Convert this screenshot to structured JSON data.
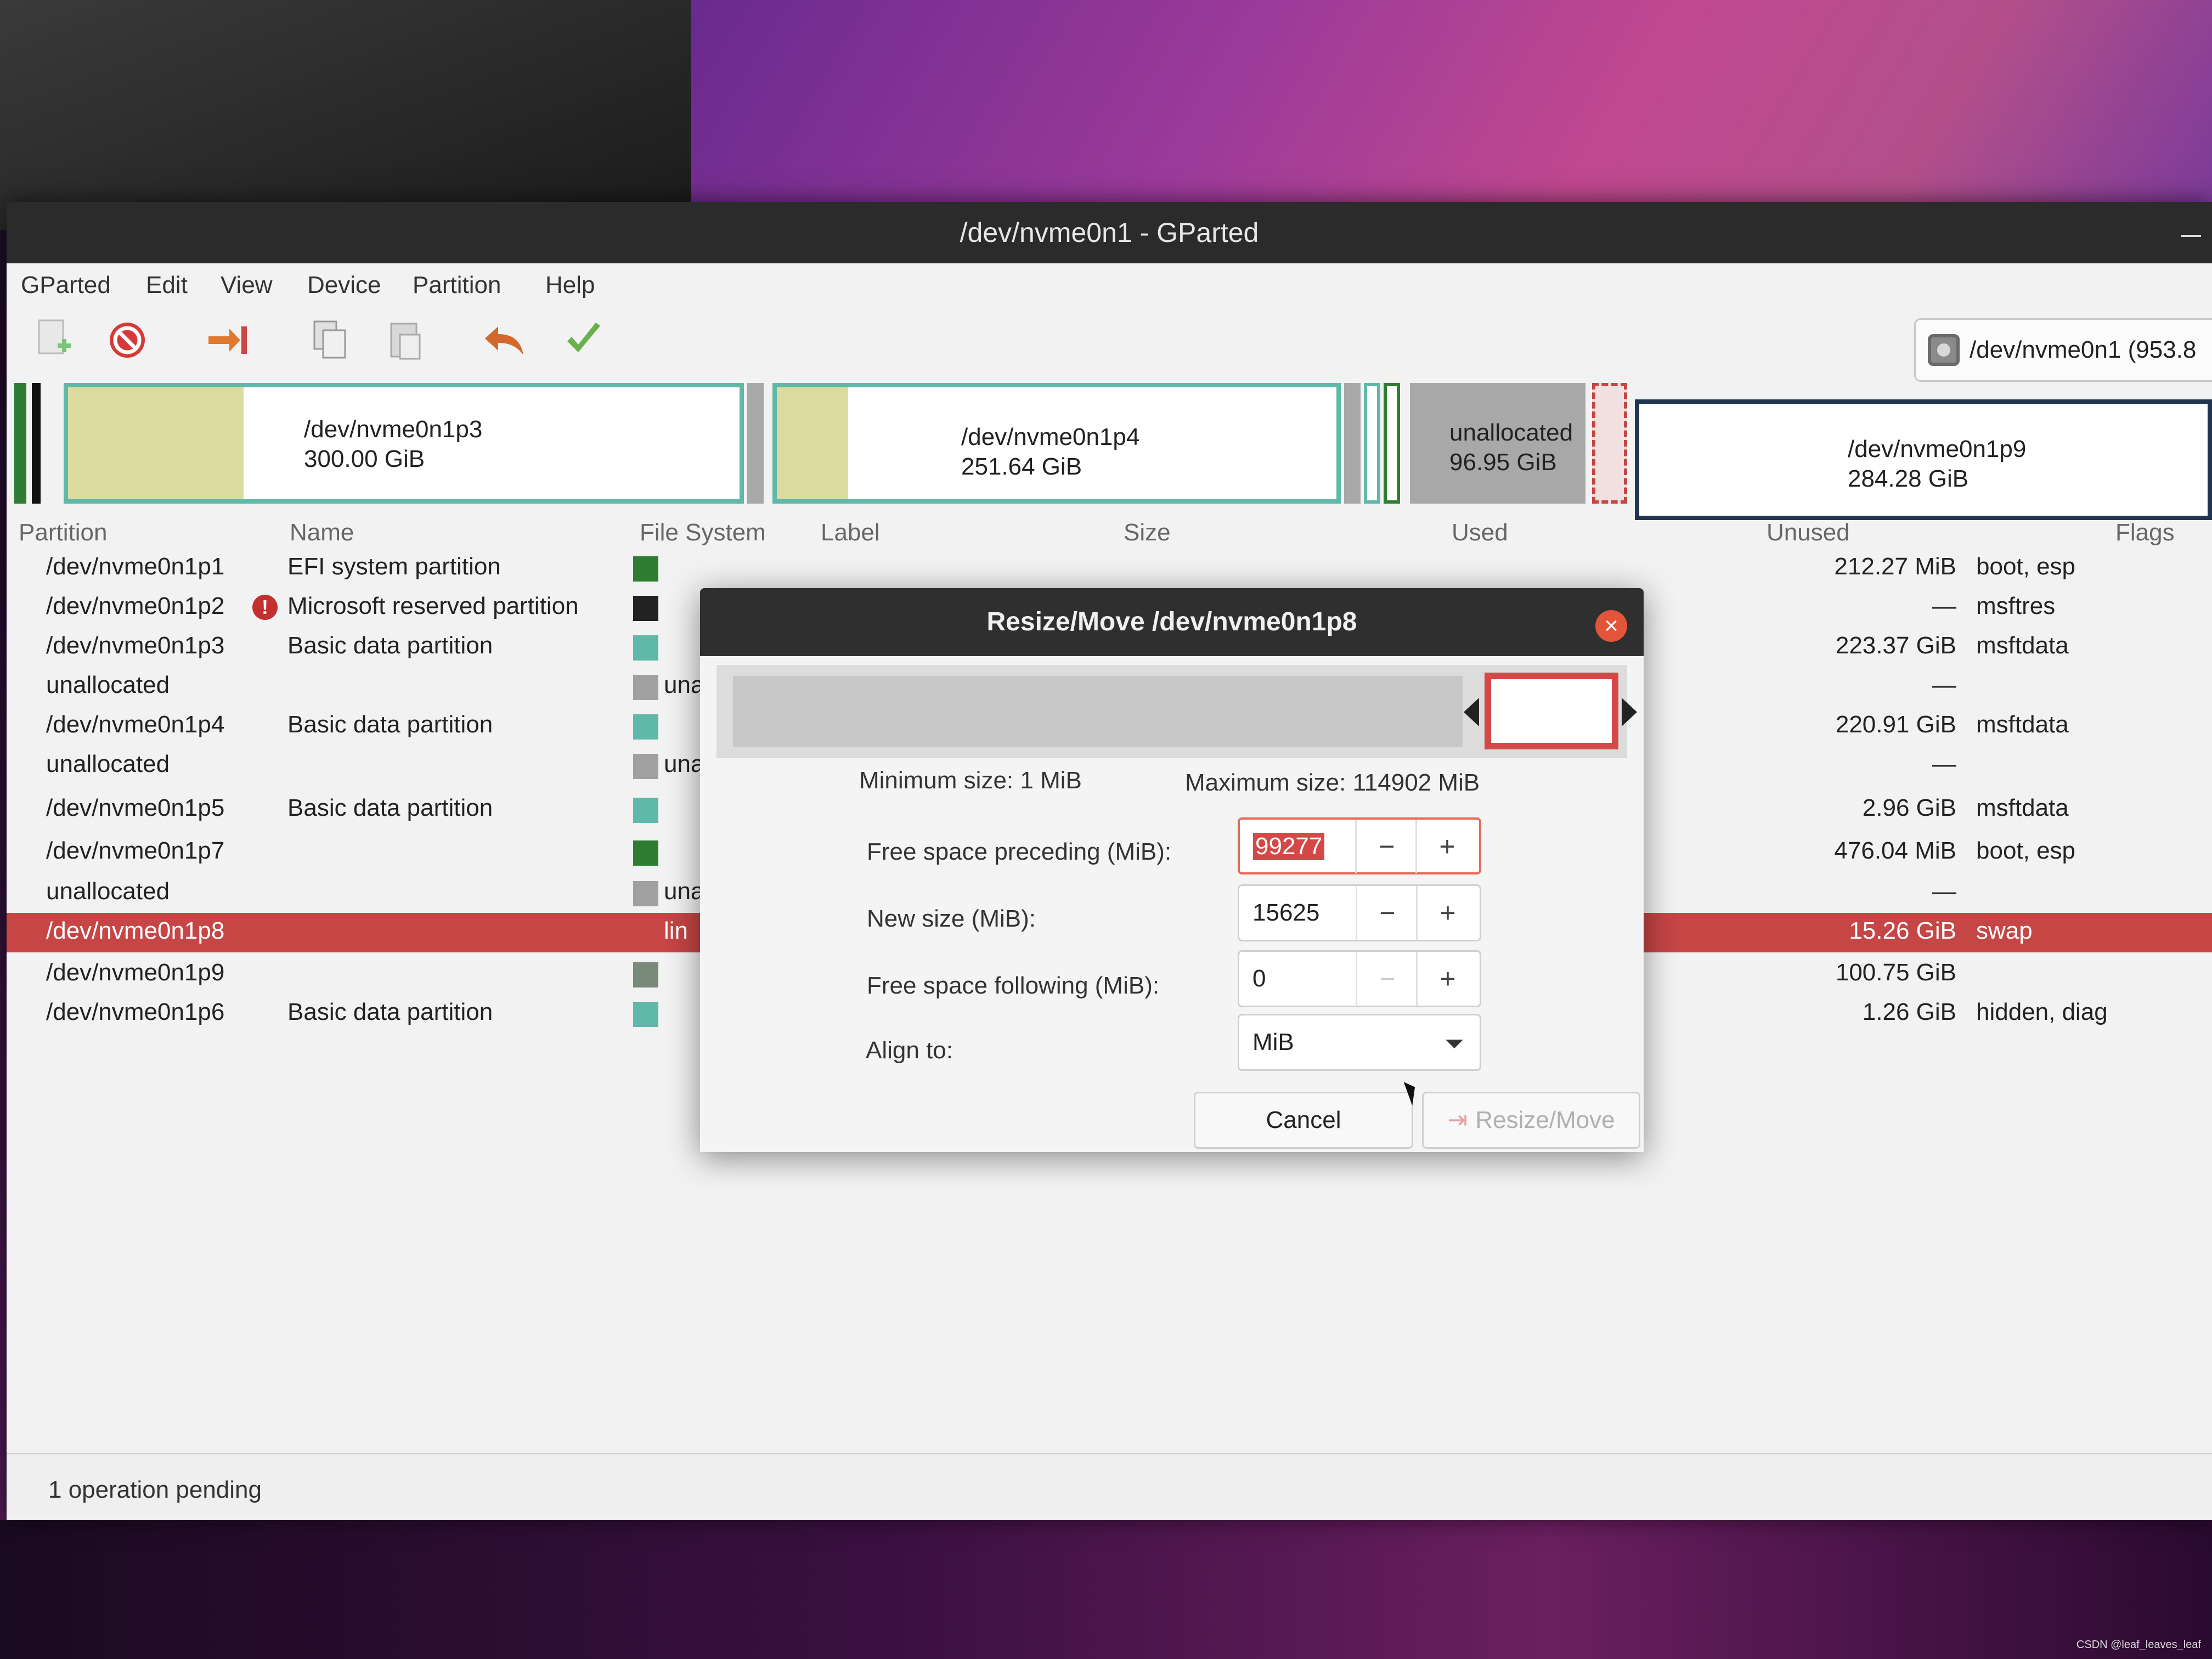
{
  "window": {
    "title": "/dev/nvme0n1 - GParted"
  },
  "menu": [
    "GParted",
    "Edit",
    "View",
    "Device",
    "Partition",
    "Help"
  ],
  "device_selector": {
    "label": "/dev/nvme0n1 (953.8"
  },
  "diskbar": {
    "p3": {
      "name": "/dev/nvme0n1p3",
      "size": "300.00 GiB"
    },
    "p4": {
      "name": "/dev/nvme0n1p4",
      "size": "251.64 GiB"
    },
    "unalloc": {
      "name": "unallocated",
      "size": "96.95 GiB"
    },
    "p9": {
      "name": "/dev/nvme0n1p9",
      "size": "284.28 GiB"
    }
  },
  "columns": {
    "partition": "Partition",
    "name": "Name",
    "filesystem": "File System",
    "label": "Label",
    "size": "Size",
    "used": "Used",
    "unused": "Unused",
    "flags": "Flags"
  },
  "rows": [
    {
      "partition": "/dev/nvme0n1p1",
      "name": "EFI system partition",
      "color": "#2e7d32",
      "fs": "",
      "unused": "212.27 MiB",
      "flags": "boot, esp"
    },
    {
      "partition": "/dev/nvme0n1p2",
      "name": "Microsoft reserved partition",
      "color": "#222222",
      "fs": "",
      "unused": "—",
      "flags": "msftres",
      "warn": "!"
    },
    {
      "partition": "/dev/nvme0n1p3",
      "name": "Basic data partition",
      "color": "#5fb8a8",
      "fs": "",
      "unused": "223.37 GiB",
      "flags": "msftdata"
    },
    {
      "partition": "unallocated",
      "name": "",
      "color": "#a0a0a0",
      "fs": "una",
      "unused": "—",
      "flags": ""
    },
    {
      "partition": "/dev/nvme0n1p4",
      "name": "Basic data partition",
      "color": "#5fb8a8",
      "fs": "",
      "unused": "220.91 GiB",
      "flags": "msftdata"
    },
    {
      "partition": "unallocated",
      "name": "",
      "color": "#a0a0a0",
      "fs": "una",
      "unused": "—",
      "flags": ""
    },
    {
      "partition": "/dev/nvme0n1p5",
      "name": "Basic data partition",
      "color": "#5fb8a8",
      "fs": "",
      "unused": "2.96 GiB",
      "flags": "msftdata"
    },
    {
      "partition": "/dev/nvme0n1p7",
      "name": "",
      "color": "#2e7d32",
      "fs": "",
      "unused": "476.04 MiB",
      "flags": "boot, esp"
    },
    {
      "partition": "unallocated",
      "name": "",
      "color": "#a0a0a0",
      "fs": "una",
      "unused": "—",
      "flags": ""
    },
    {
      "partition": "/dev/nvme0n1p8",
      "name": "",
      "color": "#c64545",
      "fs": "lin",
      "unused": "15.26 GiB",
      "flags": "swap",
      "selected": true
    },
    {
      "partition": "/dev/nvme0n1p9",
      "name": "",
      "color": "#7a8a7a",
      "fs": "",
      "unused": "100.75 GiB",
      "flags": ""
    },
    {
      "partition": "/dev/nvme0n1p6",
      "name": "Basic data partition",
      "color": "#5fb8a8",
      "fs": "",
      "unused": "1.26 GiB",
      "flags": "hidden, diag"
    }
  ],
  "status": "1 operation pending",
  "dialog": {
    "title": "Resize/Move /dev/nvme0n1p8",
    "min_size": "Minimum size: 1 MiB",
    "max_size": "Maximum size: 114902 MiB",
    "fields": {
      "preceding": {
        "label": "Free space preceding (MiB):",
        "value": "99277"
      },
      "new_size": {
        "label": "New size (MiB):",
        "value": "15625"
      },
      "following": {
        "label": "Free space following (MiB):",
        "value": "0"
      }
    },
    "align": {
      "label": "Align to:",
      "value": "MiB"
    },
    "minus": "−",
    "plus": "+",
    "buttons": {
      "cancel": "Cancel",
      "resize": "Resize/Move"
    }
  },
  "watermark": "CSDN @leaf_leaves_leaf"
}
